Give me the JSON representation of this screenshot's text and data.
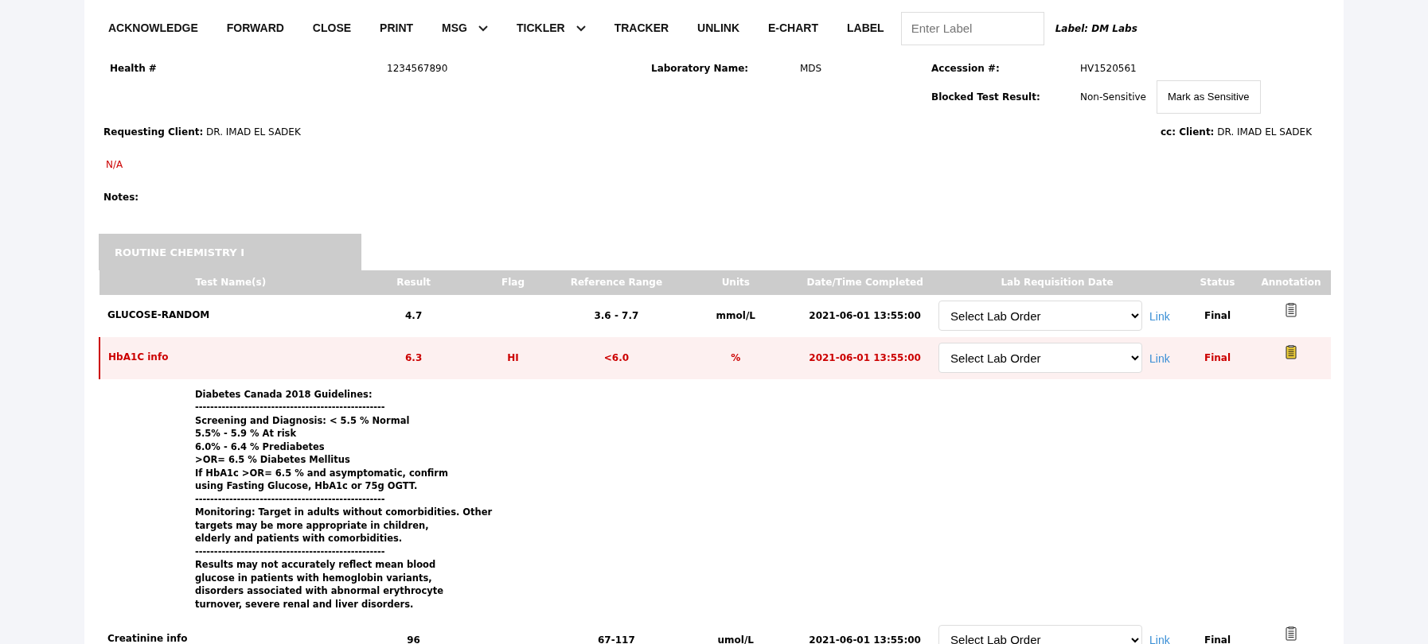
{
  "toolbar": {
    "items": [
      {
        "label": "ACKNOWLEDGE",
        "kind": "button"
      },
      {
        "label": "FORWARD",
        "kind": "button"
      },
      {
        "label": "CLOSE",
        "kind": "button"
      },
      {
        "label": "PRINT",
        "kind": "button"
      },
      {
        "label": "MSG",
        "kind": "dropdown"
      },
      {
        "label": "TICKLER",
        "kind": "dropdown"
      },
      {
        "label": "TRACKER",
        "kind": "button"
      },
      {
        "label": "UNLINK",
        "kind": "button"
      },
      {
        "label": "E-CHART",
        "kind": "button"
      },
      {
        "label": "LABEL",
        "kind": "button"
      }
    ],
    "label_field": {
      "placeholder": "Enter Label"
    },
    "current_label": "Label: DM Labs"
  },
  "header_fields": [
    {
      "label": "Health #",
      "value": "1234567890"
    },
    {
      "label": "Laboratory Name:",
      "value": "MDS"
    },
    {
      "label": "Accession #:",
      "value": "HV1520561"
    }
  ],
  "blocked_test_result": {
    "label": "Blocked Test Result:",
    "value": "Non-Sensitive",
    "button": "Mark as Sensitive"
  },
  "requesting_client": {
    "label": "Requesting Client:",
    "value": "DR. IMAD EL SADEK"
  },
  "cc_client": {
    "label": "cc: Client:",
    "value": "DR. IMAD EL SADEK"
  },
  "status_note": "N/A",
  "notes_label": "Notes:",
  "section": {
    "title": "ROUTINE CHEMISTRY I",
    "columns": [
      "Test Name(s)",
      "Result",
      "Flag",
      "Reference Range",
      "Units",
      "Date/Time Completed",
      "Lab Requisition Date",
      "Status",
      "Annotation"
    ],
    "rows": [
      {
        "name": "GLUCOSE-RANDOM",
        "result": "4.7",
        "flag": "",
        "reference_range": "3.6 - 7.7",
        "units": "mmol/L",
        "completed": "2021-06-01 13:55:00",
        "lab_order": "Select Lab Order",
        "link": "Link",
        "status": "Final",
        "abnormal": false,
        "annotated": false
      },
      {
        "name": "HbA1C info",
        "result": "6.3",
        "flag": "HI",
        "reference_range": "<6.0",
        "units": "%",
        "completed": "2021-06-01 13:55:00",
        "lab_order": "Select Lab Order",
        "link": "Link",
        "status": "Final",
        "abnormal": true,
        "annotated": true,
        "comment": [
          "Diabetes Canada 2018 Guidelines:",
          "--------------------------------------------------",
          "Screening and Diagnosis: < 5.5 % Normal",
          "5.5% - 5.9 % At risk",
          "6.0% - 6.4 % Prediabetes",
          ">OR= 6.5 % Diabetes Mellitus",
          "If HbA1c >OR= 6.5 % and asymptomatic, confirm",
          "using Fasting Glucose, HbA1c or 75g OGTT.",
          "--------------------------------------------------",
          "Monitoring: Target in adults without comorbidities. Other",
          "targets may be more appropriate in children,",
          "elderly and patients with comorbidities.",
          "--------------------------------------------------",
          "Results may not accurately reflect mean blood",
          "glucose in patients with hemoglobin variants,",
          "disorders associated with abnormal erythrocyte",
          "turnover, severe renal and liver disorders."
        ]
      },
      {
        "name": "Creatinine info",
        "result": "96",
        "flag": "",
        "reference_range": "67-117",
        "units": "umol/L",
        "completed": "2021-06-01 13:55:00",
        "lab_order": "Select Lab Order",
        "link": "Link",
        "status": "Final",
        "abnormal": false,
        "annotated": false
      }
    ]
  }
}
